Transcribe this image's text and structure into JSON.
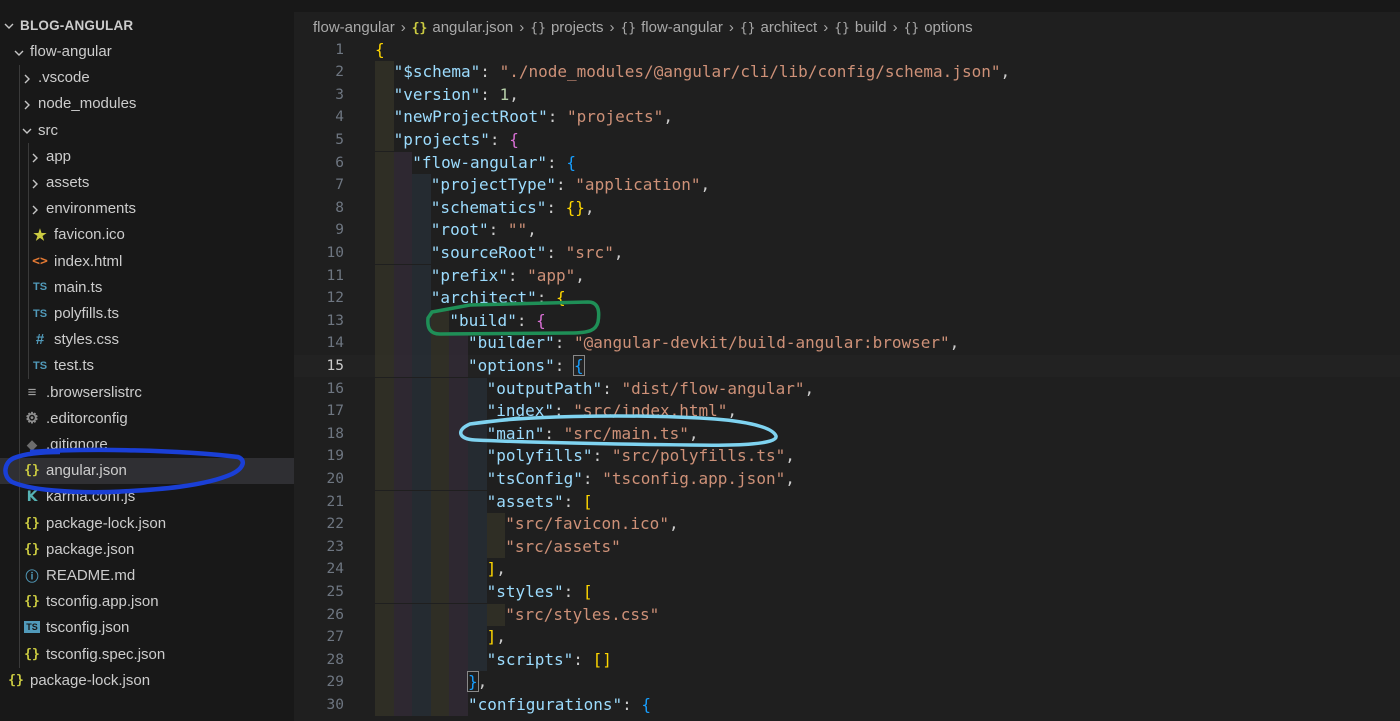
{
  "sidebar": {
    "root_label": "BLOG-ANGULAR",
    "items": [
      {
        "label": "flow-angular",
        "kind": "folder-open",
        "depth": 1
      },
      {
        "label": ".vscode",
        "kind": "folder",
        "depth": 2
      },
      {
        "label": "node_modules",
        "kind": "folder",
        "depth": 2
      },
      {
        "label": "src",
        "kind": "folder-open",
        "depth": 2
      },
      {
        "label": "app",
        "kind": "folder",
        "depth": 3
      },
      {
        "label": "assets",
        "kind": "folder",
        "depth": 3
      },
      {
        "label": "environments",
        "kind": "folder",
        "depth": 3
      },
      {
        "label": "favicon.ico",
        "kind": "file",
        "icon": "star-icon",
        "depth": 3
      },
      {
        "label": "index.html",
        "kind": "file",
        "icon": "html-icon",
        "depth": 3
      },
      {
        "label": "main.ts",
        "kind": "file",
        "icon": "typescript-icon",
        "depth": 3
      },
      {
        "label": "polyfills.ts",
        "kind": "file",
        "icon": "typescript-icon",
        "depth": 3
      },
      {
        "label": "styles.css",
        "kind": "file",
        "icon": "css-icon",
        "depth": 3
      },
      {
        "label": "test.ts",
        "kind": "file",
        "icon": "typescript-icon",
        "depth": 3
      },
      {
        "label": ".browserslistrc",
        "kind": "file",
        "icon": "lines-icon",
        "depth": 2
      },
      {
        "label": ".editorconfig",
        "kind": "file",
        "icon": "gear-icon",
        "depth": 2
      },
      {
        "label": ".gitignore",
        "kind": "file",
        "icon": "git-icon",
        "depth": 2
      },
      {
        "label": "angular.json",
        "kind": "file",
        "icon": "json-icon",
        "depth": 2,
        "selected": true
      },
      {
        "label": "karma.conf.js",
        "kind": "file",
        "icon": "karma-icon",
        "depth": 2
      },
      {
        "label": "package-lock.json",
        "kind": "file",
        "icon": "json-icon",
        "depth": 2
      },
      {
        "label": "package.json",
        "kind": "file",
        "icon": "json-icon",
        "depth": 2
      },
      {
        "label": "README.md",
        "kind": "file",
        "icon": "info-icon",
        "depth": 2
      },
      {
        "label": "tsconfig.app.json",
        "kind": "file",
        "icon": "json-icon",
        "depth": 2
      },
      {
        "label": "tsconfig.json",
        "kind": "file",
        "icon": "tsconfig-icon",
        "depth": 2
      },
      {
        "label": "tsconfig.spec.json",
        "kind": "file",
        "icon": "json-icon",
        "depth": 2
      },
      {
        "label": "package-lock.json",
        "kind": "file",
        "icon": "json-icon",
        "depth": 1
      }
    ]
  },
  "breadcrumb": [
    {
      "label": "flow-angular",
      "icon": ""
    },
    {
      "label": "angular.json",
      "icon": "{}"
    },
    {
      "label": "projects",
      "icon": "{}"
    },
    {
      "label": "flow-angular",
      "icon": "{}"
    },
    {
      "label": "architect",
      "icon": "{}"
    },
    {
      "label": "build",
      "icon": "{}"
    },
    {
      "label": "options",
      "icon": "{}"
    }
  ],
  "editor": {
    "current_line": 15,
    "lines": [
      {
        "n": 1,
        "indent": 0,
        "tokens": [
          [
            "b1",
            "{"
          ]
        ]
      },
      {
        "n": 2,
        "indent": 1,
        "tokens": [
          [
            "key",
            "\"$schema\""
          ],
          [
            "p",
            ": "
          ],
          [
            "str",
            "\"./node_modules/@angular/cli/lib/config/schema.json\""
          ],
          [
            "p",
            ","
          ]
        ]
      },
      {
        "n": 3,
        "indent": 1,
        "tokens": [
          [
            "key",
            "\"version\""
          ],
          [
            "p",
            ": "
          ],
          [
            "num",
            "1"
          ],
          [
            "p",
            ","
          ]
        ]
      },
      {
        "n": 4,
        "indent": 1,
        "tokens": [
          [
            "key",
            "\"newProjectRoot\""
          ],
          [
            "p",
            ": "
          ],
          [
            "str",
            "\"projects\""
          ],
          [
            "p",
            ","
          ]
        ]
      },
      {
        "n": 5,
        "indent": 1,
        "tokens": [
          [
            "key",
            "\"projects\""
          ],
          [
            "p",
            ": "
          ],
          [
            "b2",
            "{"
          ]
        ]
      },
      {
        "n": 6,
        "indent": 2,
        "tokens": [
          [
            "key",
            "\"flow-angular\""
          ],
          [
            "p",
            ": "
          ],
          [
            "b3",
            "{"
          ]
        ]
      },
      {
        "n": 7,
        "indent": 3,
        "tokens": [
          [
            "key",
            "\"projectType\""
          ],
          [
            "p",
            ": "
          ],
          [
            "str",
            "\"application\""
          ],
          [
            "p",
            ","
          ]
        ]
      },
      {
        "n": 8,
        "indent": 3,
        "tokens": [
          [
            "key",
            "\"schematics\""
          ],
          [
            "p",
            ": "
          ],
          [
            "b1",
            "{}"
          ],
          [
            "p",
            ","
          ]
        ]
      },
      {
        "n": 9,
        "indent": 3,
        "tokens": [
          [
            "key",
            "\"root\""
          ],
          [
            "p",
            ": "
          ],
          [
            "str",
            "\"\""
          ],
          [
            "p",
            ","
          ]
        ]
      },
      {
        "n": 10,
        "indent": 3,
        "tokens": [
          [
            "key",
            "\"sourceRoot\""
          ],
          [
            "p",
            ": "
          ],
          [
            "str",
            "\"src\""
          ],
          [
            "p",
            ","
          ]
        ]
      },
      {
        "n": 11,
        "indent": 3,
        "tokens": [
          [
            "key",
            "\"prefix\""
          ],
          [
            "p",
            ": "
          ],
          [
            "str",
            "\"app\""
          ],
          [
            "p",
            ","
          ]
        ]
      },
      {
        "n": 12,
        "indent": 3,
        "tokens": [
          [
            "key",
            "\"architect\""
          ],
          [
            "p",
            ": "
          ],
          [
            "b1",
            "{"
          ]
        ]
      },
      {
        "n": 13,
        "indent": 4,
        "tokens": [
          [
            "key",
            "\"build\""
          ],
          [
            "p",
            ": "
          ],
          [
            "b2",
            "{"
          ]
        ]
      },
      {
        "n": 14,
        "indent": 5,
        "tokens": [
          [
            "key",
            "\"builder\""
          ],
          [
            "p",
            ": "
          ],
          [
            "str",
            "\"@angular-devkit/build-angular:browser\""
          ],
          [
            "p",
            ","
          ]
        ]
      },
      {
        "n": 15,
        "indent": 5,
        "tokens": [
          [
            "key",
            "\"options\""
          ],
          [
            "p",
            ": "
          ],
          [
            "b3box",
            "{"
          ]
        ]
      },
      {
        "n": 16,
        "indent": 6,
        "tokens": [
          [
            "key",
            "\"outputPath\""
          ],
          [
            "p",
            ": "
          ],
          [
            "str",
            "\"dist/flow-angular\""
          ],
          [
            "p",
            ","
          ]
        ]
      },
      {
        "n": 17,
        "indent": 6,
        "tokens": [
          [
            "key",
            "\"index\""
          ],
          [
            "p",
            ": "
          ],
          [
            "str",
            "\"src/index.html\""
          ],
          [
            "p",
            ","
          ]
        ]
      },
      {
        "n": 18,
        "indent": 6,
        "tokens": [
          [
            "key",
            "\"main\""
          ],
          [
            "p",
            ": "
          ],
          [
            "str",
            "\"src/main.ts\""
          ],
          [
            "p",
            ","
          ]
        ]
      },
      {
        "n": 19,
        "indent": 6,
        "tokens": [
          [
            "key",
            "\"polyfills\""
          ],
          [
            "p",
            ": "
          ],
          [
            "str",
            "\"src/polyfills.ts\""
          ],
          [
            "p",
            ","
          ]
        ]
      },
      {
        "n": 20,
        "indent": 6,
        "tokens": [
          [
            "key",
            "\"tsConfig\""
          ],
          [
            "p",
            ": "
          ],
          [
            "str",
            "\"tsconfig.app.json\""
          ],
          [
            "p",
            ","
          ]
        ]
      },
      {
        "n": 21,
        "indent": 6,
        "tokens": [
          [
            "key",
            "\"assets\""
          ],
          [
            "p",
            ": "
          ],
          [
            "b1",
            "["
          ]
        ]
      },
      {
        "n": 22,
        "indent": 7,
        "tokens": [
          [
            "str",
            "\"src/favicon.ico\""
          ],
          [
            "p",
            ","
          ]
        ]
      },
      {
        "n": 23,
        "indent": 7,
        "tokens": [
          [
            "str",
            "\"src/assets\""
          ]
        ]
      },
      {
        "n": 24,
        "indent": 6,
        "tokens": [
          [
            "b1",
            "]"
          ],
          [
            "p",
            ","
          ]
        ]
      },
      {
        "n": 25,
        "indent": 6,
        "tokens": [
          [
            "key",
            "\"styles\""
          ],
          [
            "p",
            ": "
          ],
          [
            "b1",
            "["
          ]
        ]
      },
      {
        "n": 26,
        "indent": 7,
        "tokens": [
          [
            "str",
            "\"src/styles.css\""
          ]
        ]
      },
      {
        "n": 27,
        "indent": 6,
        "tokens": [
          [
            "b1",
            "]"
          ],
          [
            "p",
            ","
          ]
        ]
      },
      {
        "n": 28,
        "indent": 6,
        "tokens": [
          [
            "key",
            "\"scripts\""
          ],
          [
            "p",
            ": "
          ],
          [
            "b1",
            "[]"
          ]
        ]
      },
      {
        "n": 29,
        "indent": 5,
        "tokens": [
          [
            "b3box",
            "}"
          ],
          [
            "p",
            ","
          ]
        ]
      },
      {
        "n": 30,
        "indent": 5,
        "tokens": [
          [
            "key",
            "\"configurations\""
          ],
          [
            "p",
            ": "
          ],
          [
            "b3",
            "{"
          ]
        ]
      }
    ]
  },
  "annotations": [
    {
      "name": "build-highlight-annotation",
      "color": "#1f8f57"
    },
    {
      "name": "main-highlight-annotation",
      "color": "#7fd3f0"
    },
    {
      "name": "angular-json-highlight-annotation",
      "color": "#1a3fd6"
    }
  ]
}
